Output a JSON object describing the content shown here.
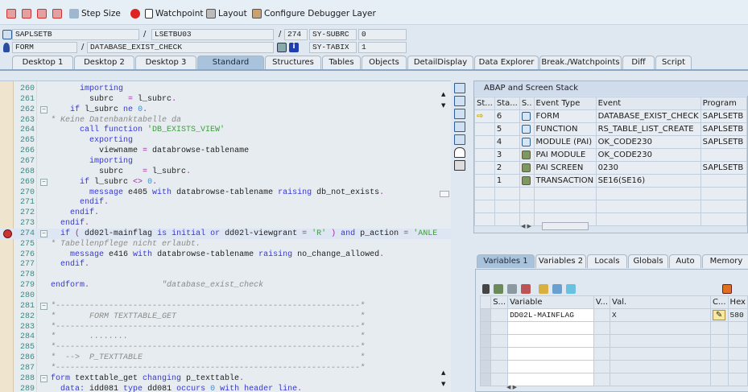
{
  "toolbar": {
    "step_size": "Step Size",
    "watchpoint": "Watchpoint",
    "layout": "Layout",
    "configure_layer": "Configure Debugger Layer"
  },
  "context": {
    "program": "SAPLSETB",
    "include": "LSETBU03",
    "line": "274",
    "sy_subrc_label": "SY-SUBRC",
    "sy_subrc_value": "0",
    "event_type": "FORM",
    "event_name": "DATABASE_EXIST_CHECK",
    "sy_tabix_label": "SY-TABIX",
    "sy_tabix_value": "1",
    "sep": "/"
  },
  "tabs": [
    "Desktop 1",
    "Desktop 2",
    "Desktop 3",
    "Standard",
    "Structures",
    "Tables",
    "Objects",
    "DetailDisplay",
    "Data Explorer",
    "Break./Watchpoints",
    "Diff",
    "Script"
  ],
  "active_tab": "Standard",
  "code": [
    {
      "n": "260",
      "f": "",
      "s": [
        [
          "",
          "      "
        ],
        [
          "kw",
          "importing"
        ]
      ]
    },
    {
      "n": "261",
      "f": "",
      "s": [
        [
          "",
          "        "
        ],
        [
          "id",
          "subrc   "
        ],
        [
          "op",
          "="
        ],
        [
          "id",
          " l_subrc"
        ],
        [
          "op",
          "."
        ]
      ]
    },
    {
      "n": "262",
      "f": "-",
      "s": [
        [
          "",
          "    "
        ],
        [
          "kw",
          "if"
        ],
        [
          "id",
          " l_subrc "
        ],
        [
          "kw",
          "ne"
        ],
        [
          "nm",
          " 0"
        ],
        [
          "op",
          "."
        ]
      ]
    },
    {
      "n": "263",
      "f": "",
      "s": [
        [
          "cm",
          "* Keine Datenbanktabelle da"
        ]
      ]
    },
    {
      "n": "264",
      "f": "",
      "s": [
        [
          "",
          "      "
        ],
        [
          "kw",
          "call function"
        ],
        [
          "str",
          " 'DB_EXISTS_VIEW'"
        ]
      ]
    },
    {
      "n": "265",
      "f": "",
      "s": [
        [
          "",
          "        "
        ],
        [
          "kw",
          "exporting"
        ]
      ]
    },
    {
      "n": "266",
      "f": "",
      "s": [
        [
          "",
          "          "
        ],
        [
          "id",
          "viewname "
        ],
        [
          "op",
          "="
        ],
        [
          "id",
          " databrowse-tablename"
        ]
      ]
    },
    {
      "n": "267",
      "f": "",
      "s": [
        [
          "",
          "        "
        ],
        [
          "kw",
          "importing"
        ]
      ]
    },
    {
      "n": "268",
      "f": "",
      "s": [
        [
          "",
          "          "
        ],
        [
          "id",
          "subrc    "
        ],
        [
          "op",
          "="
        ],
        [
          "id",
          " l_subrc"
        ],
        [
          "op",
          "."
        ]
      ]
    },
    {
      "n": "269",
      "f": "-",
      "s": [
        [
          "",
          "      "
        ],
        [
          "kw",
          "if"
        ],
        [
          "id",
          " l_subrc "
        ],
        [
          "op",
          "<>"
        ],
        [
          "nm",
          " 0"
        ],
        [
          "op",
          "."
        ]
      ]
    },
    {
      "n": "270",
      "f": "",
      "s": [
        [
          "",
          "        "
        ],
        [
          "kw",
          "message"
        ],
        [
          "id",
          " e405 "
        ],
        [
          "kw",
          "with"
        ],
        [
          "id",
          " databrowse-tablename "
        ],
        [
          "kw",
          "raising"
        ],
        [
          "id",
          " db_not_exists"
        ],
        [
          "op",
          "."
        ]
      ]
    },
    {
      "n": "271",
      "f": "",
      "s": [
        [
          "",
          "      "
        ],
        [
          "kw",
          "endif"
        ],
        [
          "op",
          "."
        ]
      ]
    },
    {
      "n": "272",
      "f": "",
      "s": [
        [
          "",
          "    "
        ],
        [
          "kw",
          "endif"
        ],
        [
          "op",
          "."
        ]
      ]
    },
    {
      "n": "273",
      "f": "",
      "s": [
        [
          "",
          "  "
        ],
        [
          "kw",
          "endif"
        ],
        [
          "op",
          "."
        ]
      ]
    },
    {
      "n": "274",
      "f": "-",
      "cur": true,
      "s": [
        [
          "",
          "  "
        ],
        [
          "kw",
          "if"
        ],
        [
          "op",
          " ("
        ],
        [
          "id",
          " dd02l-mainflag "
        ],
        [
          "kw",
          "is initial or"
        ],
        [
          "id",
          " dd02l-viewgrant "
        ],
        [
          "op",
          "="
        ],
        [
          "str",
          " 'R'"
        ],
        [
          "op",
          " )"
        ],
        [
          "kw",
          " and"
        ],
        [
          "id",
          " p_action "
        ],
        [
          "op",
          "="
        ],
        [
          "str",
          " 'ANLE"
        ]
      ]
    },
    {
      "n": "275",
      "f": "",
      "s": [
        [
          "cm",
          "* Tabellenpflege nicht erlaubt."
        ]
      ]
    },
    {
      "n": "276",
      "f": "",
      "s": [
        [
          "",
          "    "
        ],
        [
          "kw",
          "message"
        ],
        [
          "id",
          " e416 "
        ],
        [
          "kw",
          "with"
        ],
        [
          "id",
          " databrowse-tablename "
        ],
        [
          "kw",
          "raising"
        ],
        [
          "id",
          " no_change_allowed"
        ],
        [
          "op",
          "."
        ]
      ]
    },
    {
      "n": "277",
      "f": "",
      "s": [
        [
          "",
          "  "
        ],
        [
          "kw",
          "endif"
        ],
        [
          "op",
          "."
        ]
      ]
    },
    {
      "n": "278",
      "f": "",
      "s": []
    },
    {
      "n": "279",
      "f": "",
      "s": [
        [
          "kw",
          "endform"
        ],
        [
          "op",
          "."
        ],
        [
          "",
          "               "
        ],
        [
          "cm",
          "\"database_exist_check"
        ]
      ]
    },
    {
      "n": "280",
      "f": "",
      "s": []
    },
    {
      "n": "281",
      "f": "-",
      "s": [
        [
          "cm",
          "*---------------------------------------------------------------*"
        ]
      ]
    },
    {
      "n": "282",
      "f": "",
      "s": [
        [
          "cm",
          "*       FORM TEXTTABLE_GET                                      *"
        ]
      ]
    },
    {
      "n": "283",
      "f": "",
      "s": [
        [
          "cm",
          "*---------------------------------------------------------------*"
        ]
      ]
    },
    {
      "n": "284",
      "f": "",
      "s": [
        [
          "cm",
          "*       ........                                                *"
        ]
      ]
    },
    {
      "n": "285",
      "f": "",
      "s": [
        [
          "cm",
          "*---------------------------------------------------------------*"
        ]
      ]
    },
    {
      "n": "286",
      "f": "",
      "s": [
        [
          "cm",
          "*  -->  P_TEXTTABLE                                             *"
        ]
      ]
    },
    {
      "n": "287",
      "f": "",
      "s": [
        [
          "cm",
          "*---------------------------------------------------------------*"
        ]
      ]
    },
    {
      "n": "288",
      "f": "-",
      "s": [
        [
          "kw",
          "form"
        ],
        [
          "id",
          " texttable_get "
        ],
        [
          "kw",
          "changing"
        ],
        [
          "id",
          " p_texttable"
        ],
        [
          "op",
          "."
        ]
      ]
    },
    {
      "n": "289",
      "f": "",
      "s": [
        [
          "",
          "  "
        ],
        [
          "kw",
          "data:"
        ],
        [
          "id",
          " idd081 "
        ],
        [
          "kw",
          "type"
        ],
        [
          "id",
          " dd081 "
        ],
        [
          "kw",
          "occurs"
        ],
        [
          "nm",
          " 0"
        ],
        [
          "kw",
          " with header line"
        ],
        [
          "op",
          "."
        ]
      ]
    }
  ],
  "stack": {
    "title": "ABAP and Screen Stack",
    "columns": [
      "St...",
      "Sta...",
      "S..",
      "Event Type",
      "Event",
      "Program"
    ],
    "rows": [
      {
        "level": "6",
        "type": "FORM",
        "event": "DATABASE_EXIST_CHECK",
        "program": "SAPLSETB",
        "current": true,
        "icon": "abap"
      },
      {
        "level": "5",
        "type": "FUNCTION",
        "event": "RS_TABLE_LIST_CREATE",
        "program": "SAPLSETB",
        "icon": "abap"
      },
      {
        "level": "4",
        "type": "MODULE (PAI)",
        "event": "OK_CODE230",
        "program": "SAPLSETB",
        "icon": "abap"
      },
      {
        "level": "3",
        "type": "PAI MODULE",
        "event": "OK_CODE230",
        "program": "",
        "icon": "screen"
      },
      {
        "level": "2",
        "type": "PAI SCREEN",
        "event": "0230",
        "program": "SAPLSETB",
        "icon": "screen"
      },
      {
        "level": "1",
        "type": "TRANSACTION",
        "event": "SE16(SE16)",
        "program": "",
        "icon": "screen"
      }
    ]
  },
  "var_tabs": [
    "Variables 1",
    "Variables 2",
    "Locals",
    "Globals",
    "Auto",
    "Memory Ana"
  ],
  "var_active": "Variables 1",
  "variables": {
    "columns": [
      "S...",
      "Variable",
      "V...",
      "Val.",
      "C...",
      "Hex"
    ],
    "rows": [
      {
        "name": "DD02L-MAINFLAG",
        "value": "X",
        "hex": "580"
      }
    ]
  }
}
